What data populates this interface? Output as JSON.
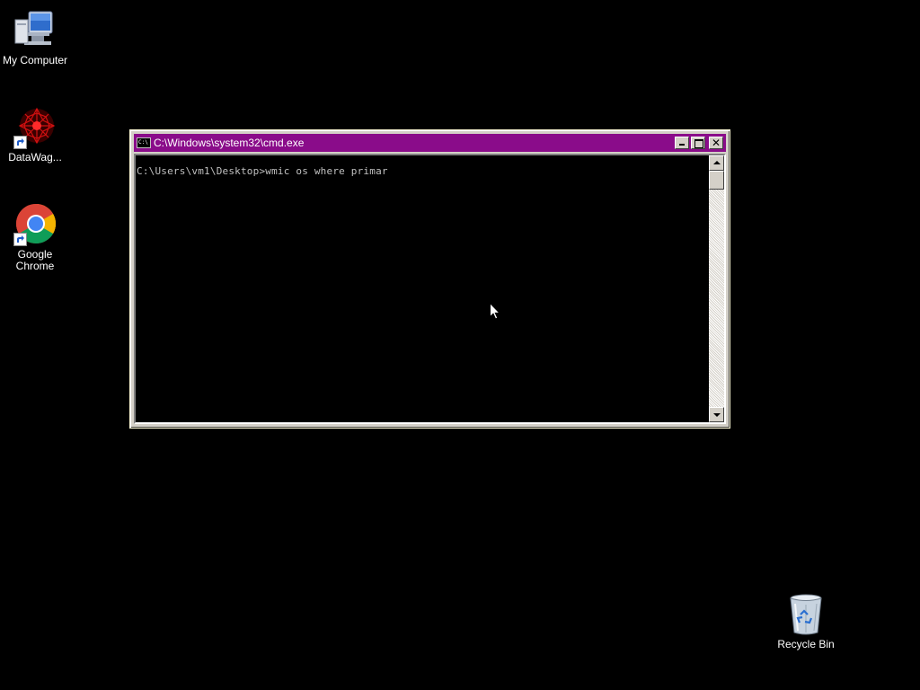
{
  "desktop": {
    "icons": [
      {
        "label": "My Computer",
        "icon": "computer-icon"
      },
      {
        "label": "DataWag...",
        "icon": "datawag-icon"
      },
      {
        "label": "Google Chrome",
        "icon": "chrome-icon"
      },
      {
        "label": "Recycle Bin",
        "icon": "recycle-bin-icon"
      }
    ]
  },
  "cmd_window": {
    "title": "C:\\Windows\\system32\\cmd.exe",
    "title_icon_text": "C:\\",
    "console_text": "C:\\Users\\vm1\\Desktop>wmic os where primar",
    "titlebar_color": "#8a0c8a",
    "text_color": "#c0c0c0",
    "buttons": [
      "minimize",
      "maximize",
      "close"
    ]
  },
  "colors": {
    "desktop_background": "#000000"
  }
}
